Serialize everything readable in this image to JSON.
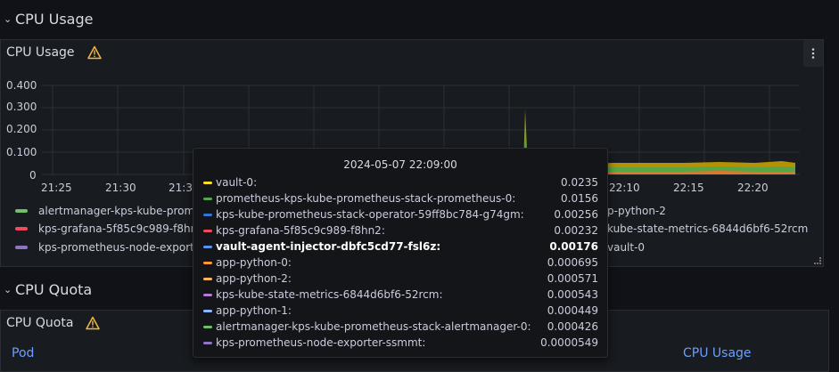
{
  "rows": [
    {
      "title": "CPU Usage"
    },
    {
      "title": "CPU Quota"
    }
  ],
  "cpu_usage_panel": {
    "title": "CPU Usage",
    "y_ticks": [
      "0.400",
      "0.300",
      "0.200",
      "0.100",
      "0"
    ],
    "x_ticks": [
      "21:25",
      "21:30",
      "21:35",
      "22:10",
      "22:15",
      "22:20"
    ],
    "legend": [
      {
        "label": "alertmanager-kps-kube-prome",
        "color": "#73bf69"
      },
      {
        "label": "kps-grafana-5f85c9c989-f8hn",
        "color": "#f2495c"
      },
      {
        "label": "kps-prometheus-node-export",
        "color": "#8f74c6"
      },
      {
        "label": "p-python-2",
        "color": "#5794f2"
      },
      {
        "label": "kube-state-metrics-6844d6bf6-52rcm",
        "color": "#ff780a"
      },
      {
        "label": "vault-0",
        "color": "#fade2a"
      }
    ]
  },
  "chart_data": {
    "type": "area",
    "ylim": [
      0,
      0.4
    ],
    "y_ticks": [
      0,
      0.1,
      0.2,
      0.3,
      0.4
    ],
    "x_ticks": [
      "21:25",
      "21:30",
      "21:35",
      "22:10",
      "22:15",
      "22:20"
    ],
    "grid": true,
    "stacked": true,
    "series": [
      {
        "name": "vault-0",
        "color": "#c4a000",
        "values": [
          0.024,
          0.024,
          0.024,
          0.025,
          0.024,
          0.026
        ]
      },
      {
        "name": "prometheus-kps-kube-prometheus-stack-prometheus-0",
        "color": "#56a64b",
        "values": [
          0.016,
          0.016,
          0.016,
          0.016,
          0.015,
          0.017
        ]
      },
      {
        "name": "kps-grafana-5f85c9c989-f8hn2",
        "color": "#e0752d",
        "values": [
          0.002,
          0.002,
          0.002,
          0.002,
          0.002,
          0.002
        ]
      }
    ],
    "spike": {
      "time": "22:07",
      "value": 0.29
    }
  },
  "tooltip": {
    "time": "2024-05-07 22:09:00",
    "rows": [
      {
        "name": "vault-0:",
        "value": "0.0235",
        "color": "#fade2a"
      },
      {
        "name": "prometheus-kps-kube-prometheus-stack-prometheus-0:",
        "value": "0.0156",
        "color": "#56a64b"
      },
      {
        "name": "kps-kube-prometheus-stack-operator-59ff8bc784-g74gm:",
        "value": "0.00256",
        "color": "#3274d9"
      },
      {
        "name": "kps-grafana-5f85c9c989-f8hn2:",
        "value": "0.00232",
        "color": "#f2495c"
      },
      {
        "name": "vault-agent-injector-dbfc5cd77-fsl6z:",
        "value": "0.00176",
        "color": "#5794f2",
        "highlight": true
      },
      {
        "name": "app-python-0:",
        "value": "0.000695",
        "color": "#ff9830"
      },
      {
        "name": "app-python-2:",
        "value": "0.000571",
        "color": "#ffb357"
      },
      {
        "name": "kps-kube-state-metrics-6844d6bf6-52rcm:",
        "value": "0.000543",
        "color": "#b877d9"
      },
      {
        "name": "app-python-1:",
        "value": "0.000449",
        "color": "#8ab8ff"
      },
      {
        "name": "alertmanager-kps-kube-prometheus-stack-alertmanager-0:",
        "value": "0.000426",
        "color": "#73bf69"
      },
      {
        "name": "kps-prometheus-node-exporter-ssmmt:",
        "value": "0.0000549",
        "color": "#8f74c6"
      }
    ]
  },
  "cpu_quota_panel": {
    "title": "CPU Quota",
    "columns": [
      "Pod",
      "CPU Usage"
    ]
  }
}
